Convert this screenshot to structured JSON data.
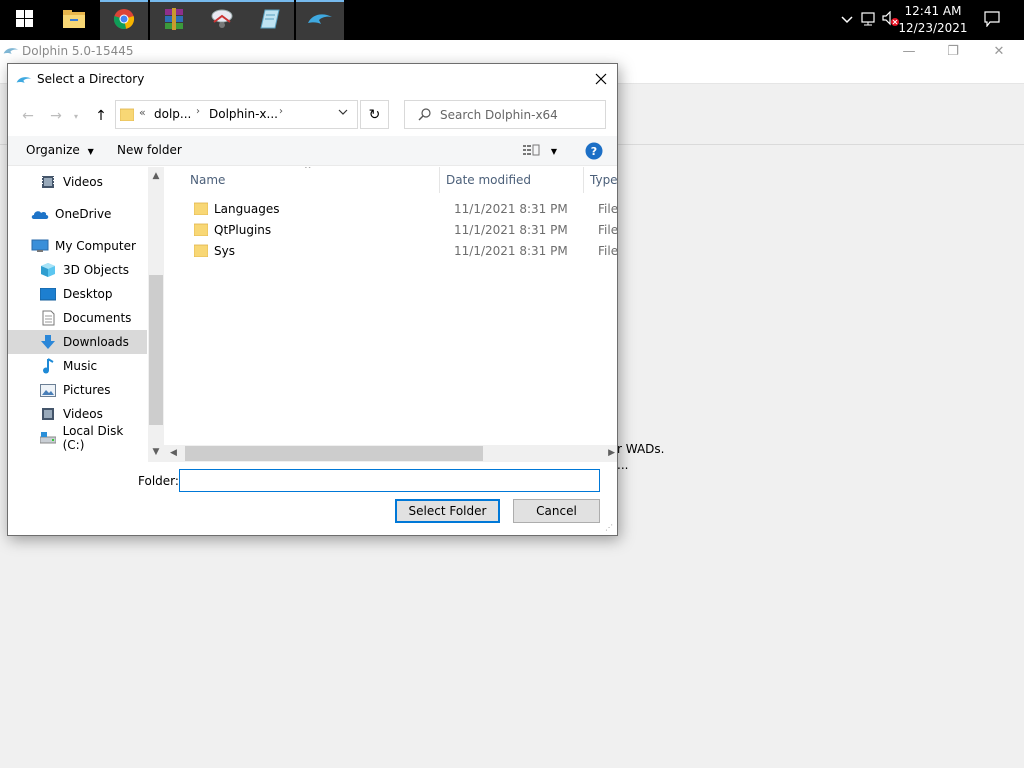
{
  "taskbar": {
    "apps": [
      {
        "name": "start-button",
        "icon": "windows-logo-icon"
      },
      {
        "name": "file-explorer",
        "icon": "folder-icon"
      },
      {
        "name": "chrome",
        "icon": "chrome-icon"
      },
      {
        "name": "winrar",
        "icon": "winrar-icon"
      },
      {
        "name": "app-4",
        "icon": "mouse-tool-icon"
      },
      {
        "name": "app-5",
        "icon": "notepad-icon"
      },
      {
        "name": "dolphin",
        "icon": "dolphin-icon"
      }
    ],
    "time": "12:41 AM",
    "date": "12/23/2021"
  },
  "dolphin_window": {
    "title": "Dolphin 5.0-15445",
    "partial_text_1": "r WADs.",
    "partial_text_2": "..."
  },
  "dialog": {
    "title": "Select a Directory",
    "breadcrumb": {
      "overflow": "«",
      "items": [
        "dolp...",
        "Dolphin-x..."
      ]
    },
    "search_placeholder": "Search Dolphin-x64",
    "toolbar": {
      "organize": "Organize",
      "new_folder": "New folder"
    },
    "nav_items": [
      {
        "label": "Videos",
        "icon": "videos-icon"
      },
      {
        "label": "OneDrive",
        "icon": "onedrive-icon"
      },
      {
        "label": "My Computer",
        "icon": "computer-icon"
      },
      {
        "label": "3D Objects",
        "icon": "3d-objects-icon"
      },
      {
        "label": "Desktop",
        "icon": "desktop-icon"
      },
      {
        "label": "Documents",
        "icon": "documents-icon"
      },
      {
        "label": "Downloads",
        "icon": "downloads-icon",
        "selected": true
      },
      {
        "label": "Music",
        "icon": "music-icon"
      },
      {
        "label": "Pictures",
        "icon": "pictures-icon"
      },
      {
        "label": "Videos",
        "icon": "videos-icon"
      },
      {
        "label": "Local Disk (C:)",
        "icon": "local-disk-icon"
      }
    ],
    "columns": {
      "name": "Name",
      "date_modified": "Date modified",
      "type": "Type"
    },
    "files": [
      {
        "name": "Languages",
        "date": "11/1/2021 8:31 PM",
        "type": "File fo"
      },
      {
        "name": "QtPlugins",
        "date": "11/1/2021 8:31 PM",
        "type": "File fo"
      },
      {
        "name": "Sys",
        "date": "11/1/2021 8:31 PM",
        "type": "File fo"
      }
    ],
    "folder_label": "Folder:",
    "folder_value": "",
    "select_button": "Select Folder",
    "cancel_button": "Cancel"
  },
  "colors": {
    "accent": "#0078d7",
    "folder": "#f8d775",
    "selected_row": "#d9d9d9"
  }
}
